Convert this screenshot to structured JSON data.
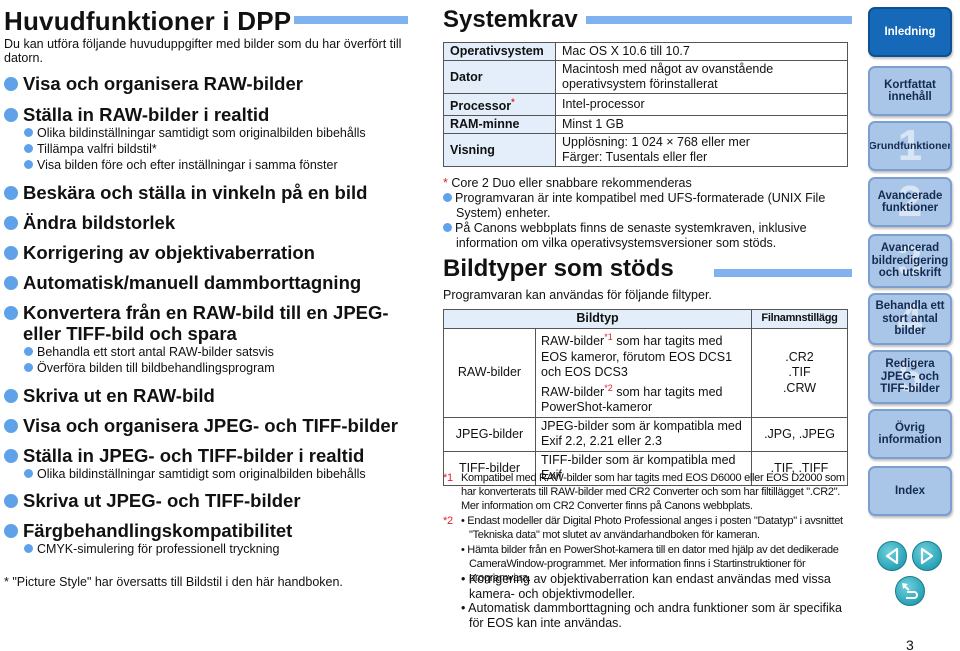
{
  "left": {
    "title": "Huvudfunktioner i DPP",
    "intro": "Du kan utföra följande huvuduppgifter med bilder som du har överfört till datorn.",
    "features": [
      {
        "label": "Visa och organisera RAW-bilder",
        "subs": []
      },
      {
        "label": "Ställa in RAW-bilder i realtid",
        "subs": [
          "Olika bildinställningar samtidigt som originalbilden bibehålls",
          "Tillämpa valfri bildstil*",
          "Visa bilden före och efter inställningar i samma fönster"
        ]
      },
      {
        "label": "Beskära och ställa in vinkeln på en bild",
        "subs": []
      },
      {
        "label": "Ändra bildstorlek",
        "subs": []
      },
      {
        "label": "Korrigering av objektivaberration",
        "subs": []
      },
      {
        "label": "Automatisk/manuell dammborttagning",
        "subs": []
      },
      {
        "label": "Konvertera från en RAW-bild till en JPEG- eller TIFF-bild och spara",
        "subs": [
          "Behandla ett stort antal RAW-bilder satsvis",
          "Överföra bilden till bildbehandlingsprogram"
        ]
      },
      {
        "label": "Skriva ut en RAW-bild",
        "subs": []
      },
      {
        "label": "Visa och organisera JPEG- och TIFF-bilder",
        "subs": []
      },
      {
        "label": "Ställa in JPEG- och TIFF-bilder i realtid",
        "subs": [
          "Olika bildinställningar samtidigt som originalbilden bibehålls"
        ]
      },
      {
        "label": "Skriva ut JPEG- och TIFF-bilder",
        "subs": []
      },
      {
        "label": "Färgbehandlingskompatibilitet",
        "subs": [
          "CMYK-simulering för professionell tryckning"
        ]
      }
    ],
    "footnote": "* \"Picture Style\" har översatts till Bildstil i den här handboken."
  },
  "system": {
    "title": "Systemkrav",
    "rows": [
      {
        "key": "Operativsystem",
        "key_mark": "",
        "value": "Mac OS X 10.6 till 10.7"
      },
      {
        "key": "Dator",
        "key_mark": "",
        "value": "Macintosh med något av ovanstående operativsystem förinstallerat"
      },
      {
        "key": "Processor",
        "key_mark": "*",
        "value": "Intel-processor"
      },
      {
        "key": "RAM-minne",
        "key_mark": "",
        "value": "Minst 1 GB"
      },
      {
        "key": "Visning",
        "key_mark": "",
        "value": "Upplösning: 1 024 × 768 eller mer",
        "value2": "Färger: Tusentals eller fler"
      }
    ],
    "note_star": "*",
    "note_core": "Core 2 Duo eller snabbare rekommenderas",
    "notes": [
      "Programvaran är inte kompatibel med UFS-formaterade (UNIX File System) enheter.",
      "På Canons webbplats finns de senaste systemkraven, inklusive information om vilka operativsystemsversioner som stöds."
    ]
  },
  "types": {
    "title": "Bildtyper som stöds",
    "intro": "Programvaran kan användas för följande filtyper.",
    "header_type": "Bildtyp",
    "header_ext": "Filnamnstillägg",
    "raw": {
      "label": "RAW-bilder",
      "line1a": "RAW-bilder",
      "mark1": "*1",
      "line1b": " som har tagits med EOS kameror, förutom EOS DCS1 och EOS DCS3",
      "line2a": "RAW-bilder",
      "mark2": "*2",
      "line2b": " som har tagits med PowerShot-kameror",
      "ext": [
        ".CR2",
        ".TIF",
        ".CRW"
      ]
    },
    "jpeg": {
      "label": "JPEG-bilder",
      "desc": "JPEG-bilder som är kompatibla med Exif 2.2, 2.21 eller 2.3",
      "ext": ".JPG, .JPEG"
    },
    "tiff": {
      "label": "TIFF-bilder",
      "desc": "TIFF-bilder som är kompatibla med Exif",
      "ext": ".TIF, .TIFF"
    },
    "fn1_mark": "*1",
    "fn1": "Kompatibel med RAW-bilder som har tagits med EOS D6000 eller EOS D2000 som har konverterats till RAW-bilder med CR2 Converter och som har filtillägget \".CR2\". Mer information om CR2 Converter finns på Canons webbplats.",
    "fn2_mark": "*2",
    "fn2_items": [
      "• Endast modeller där Digital Photo Professional anges i posten \"Datatyp\" i avsnittet \"Tekniska data\" mot slutet av användarhandboken för kameran.",
      "• Hämta bilder från en PowerShot-kamera till en dator med hjälp av det dedikerade CameraWindow-programmet. Mer information finns i Startinstruktioner för programvara."
    ],
    "fn2_large": [
      "• Korrigering av objektivaberration kan endast användas med vissa kamera- och objektivmodeller.",
      "• Automatisk dammborttagning och andra funktioner som är specifika för EOS kan inte användas."
    ]
  },
  "nav": {
    "items": [
      {
        "label": "Inledning",
        "num": "",
        "active": true
      },
      {
        "label": "Kortfattat innehåll",
        "num": "",
        "active": false
      },
      {
        "label": "Grundfunktioner",
        "num": "1",
        "active": false
      },
      {
        "label": "Avancerade funktioner",
        "num": "2",
        "active": false
      },
      {
        "label": "Avancerad bildredigering och utskrift",
        "num": "3",
        "active": false
      },
      {
        "label": "Behandla ett stort antal bilder",
        "num": "4",
        "active": false
      },
      {
        "label": "Redigera JPEG- och TIFF-bilder",
        "num": "5",
        "active": false
      },
      {
        "label": "Övrig information",
        "num": "",
        "active": false
      },
      {
        "label": "Index",
        "num": "",
        "active": false
      }
    ],
    "prev_icon": "arrow-left-icon",
    "next_icon": "arrow-right-icon",
    "back_icon": "return-icon"
  },
  "page_number": "3",
  "colors": {
    "accent_blue": "#5fa2ea",
    "title_bar": "#7fb2ee",
    "nav_active": "#1668b8",
    "nav_inactive": "#a9c6e8",
    "footnote_mark": "#dd2233",
    "table_key_bg": "#e3eefa"
  }
}
